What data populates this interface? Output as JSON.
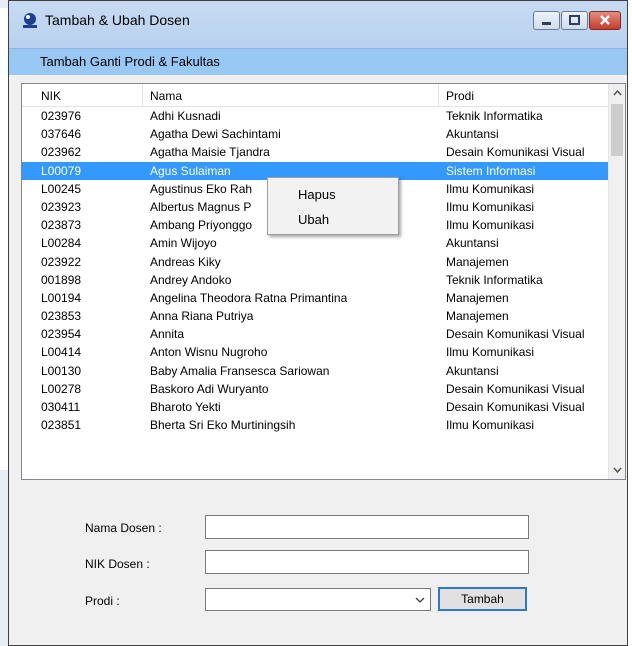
{
  "window": {
    "title": "Tambah & Ubah Dosen",
    "controls": [
      "minimize-icon",
      "maximize-icon",
      "close-icon"
    ]
  },
  "menu": {
    "item": "Tambah Ganti Prodi & Fakultas"
  },
  "list": {
    "columns": {
      "nik": "NIK",
      "nama": "Nama",
      "prodi": "Prodi"
    },
    "selected_index": 3,
    "rows": [
      {
        "nik": "023976",
        "nama": "Adhi Kusnadi",
        "prodi": "Teknik Informatika"
      },
      {
        "nik": "037646",
        "nama": "Agatha Dewi Sachintami",
        "prodi": "Akuntansi"
      },
      {
        "nik": "023962",
        "nama": "Agatha Maisie Tjandra",
        "prodi": "Desain Komunikasi Visual"
      },
      {
        "nik": "L00079",
        "nama": "Agus Sulaiman",
        "prodi": "Sistem Informasi"
      },
      {
        "nik": "L00245",
        "nama": "Agustinus Eko Rah",
        "prodi": "Ilmu Komunikasi"
      },
      {
        "nik": "023923",
        "nama": "Albertus Magnus P",
        "prodi": "Ilmu Komunikasi"
      },
      {
        "nik": "023873",
        "nama": "Ambang Priyonggo",
        "prodi": "Ilmu Komunikasi"
      },
      {
        "nik": "L00284",
        "nama": "Amin Wijoyo",
        "prodi": "Akuntansi"
      },
      {
        "nik": "023922",
        "nama": "Andreas Kiky",
        "prodi": "Manajemen"
      },
      {
        "nik": "001898",
        "nama": "Andrey Andoko",
        "prodi": "Teknik Informatika"
      },
      {
        "nik": "L00194",
        "nama": "Angelina Theodora Ratna Primantina",
        "prodi": "Manajemen"
      },
      {
        "nik": "023853",
        "nama": "Anna Riana Putriya",
        "prodi": "Manajemen"
      },
      {
        "nik": "023954",
        "nama": "Annita",
        "prodi": "Desain Komunikasi Visual"
      },
      {
        "nik": "L00414",
        "nama": "Anton Wisnu Nugroho",
        "prodi": "Ilmu Komunikasi"
      },
      {
        "nik": "L00130",
        "nama": "Baby Amalia Fransesca Sariowan",
        "prodi": "Akuntansi"
      },
      {
        "nik": "L00278",
        "nama": "Baskoro Adi Wuryanto",
        "prodi": "Desain Komunikasi Visual"
      },
      {
        "nik": "030411",
        "nama": "Bharoto Yekti",
        "prodi": "Desain Komunikasi Visual"
      },
      {
        "nik": "023851",
        "nama": "Bherta Sri Eko Murtiningsih",
        "prodi": "Ilmu Komunikasi"
      }
    ]
  },
  "context_menu": {
    "hapus": "Hapus",
    "ubah": "Ubah"
  },
  "form": {
    "nama_label": "Nama Dosen :",
    "nama_value": "",
    "nik_label": "NIK Dosen :",
    "nik_value": "",
    "prodi_label": "Prodi :",
    "prodi_value": "",
    "submit_label": "Tambah"
  },
  "colors": {
    "selection": "#3399ff",
    "menubar": "#99c8f5",
    "titlebar": "#bfd5f0"
  }
}
